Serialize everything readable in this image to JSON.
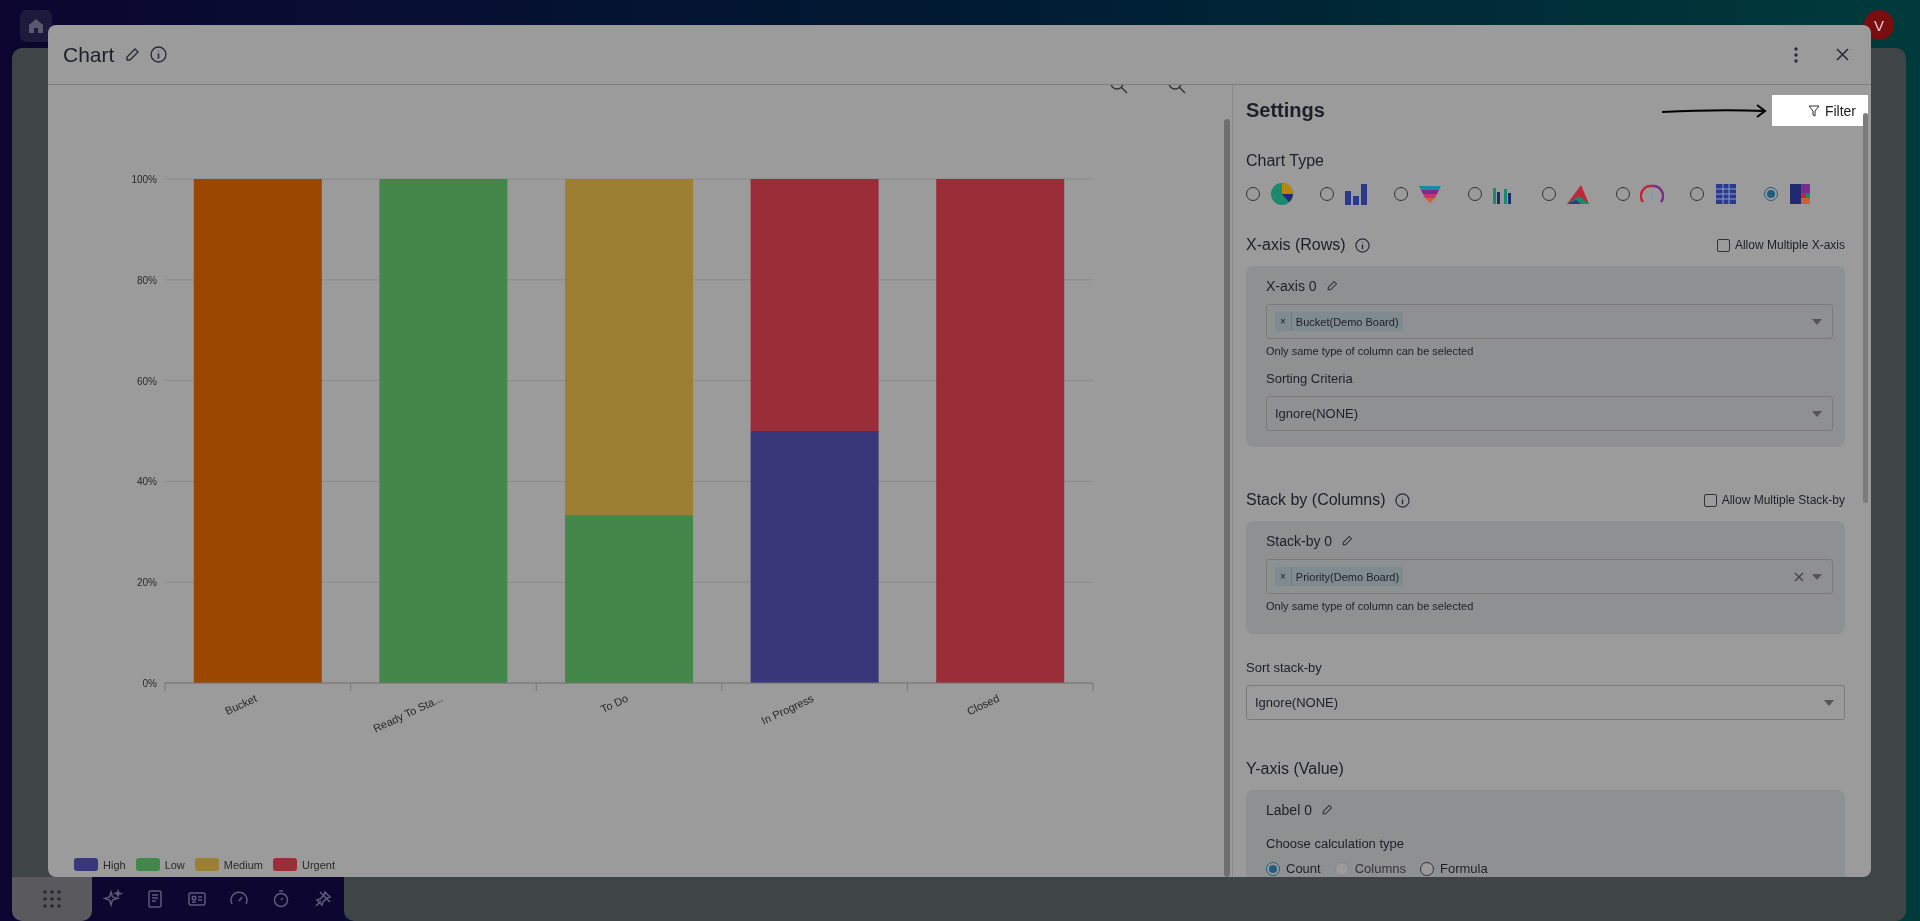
{
  "background": {
    "avatar": "V",
    "dock": [
      {
        "kind": "apps",
        "selected": true
      },
      {
        "kind": "sparkles",
        "selected": false
      },
      {
        "kind": "document",
        "selected": false
      },
      {
        "kind": "idcard",
        "selected": false
      },
      {
        "kind": "gauge",
        "selected": false
      },
      {
        "kind": "timer",
        "selected": false
      },
      {
        "kind": "unpin",
        "selected": false
      }
    ]
  },
  "modal": {
    "title": "Chart"
  },
  "chart": {
    "chart_data": {
      "type": "bar",
      "stacked": true,
      "grid": true,
      "categories": [
        "Bucket",
        "Ready To Sta...",
        "To Do",
        "In Progress",
        "Closed"
      ],
      "yticks": [
        {
          "value": 0,
          "label": "0%"
        },
        {
          "value": 20,
          "label": "20%"
        },
        {
          "value": 40,
          "label": "40%"
        },
        {
          "value": 60,
          "label": "60%"
        },
        {
          "value": 80,
          "label": "80%"
        },
        {
          "value": 100,
          "label": "100%"
        }
      ],
      "ylim": [
        0,
        100
      ],
      "series": [
        {
          "color": "#9c4700",
          "values": [
            100,
            null,
            null,
            null,
            null
          ]
        },
        {
          "name": "High",
          "color": "#383779",
          "values": [
            null,
            null,
            null,
            50,
            null
          ]
        },
        {
          "name": "Low",
          "color": "#44874a",
          "values": [
            null,
            100,
            33.3,
            null,
            null
          ]
        },
        {
          "name": "Medium",
          "color": "#9c7f32",
          "values": [
            null,
            null,
            66.7,
            null,
            null
          ]
        },
        {
          "name": "Urgent",
          "color": "#9b2d38",
          "values": [
            null,
            null,
            null,
            50,
            100
          ]
        }
      ]
    }
  },
  "settings": {
    "title": "Settings",
    "filter_button": "Filter",
    "chart_type": {
      "label": "Chart Type",
      "options": [
        {
          "kind": "pie",
          "selected": false
        },
        {
          "kind": "bar",
          "selected": false
        },
        {
          "kind": "funnel",
          "selected": false
        },
        {
          "kind": "grouped",
          "selected": false
        },
        {
          "kind": "area",
          "selected": false
        },
        {
          "kind": "gauge",
          "selected": false
        },
        {
          "kind": "table",
          "selected": false
        },
        {
          "kind": "treemap",
          "selected": true
        }
      ]
    },
    "x_axis": {
      "title": "X-axis (Rows)",
      "allow_multiple": {
        "label": "Allow Multiple X-axis",
        "checked": false
      },
      "items": [
        {
          "label": "X-axis 0",
          "tags": [
            {
              "remove": "×",
              "label": "Bucket(Demo Board)"
            }
          ],
          "clearable": false,
          "hint": "Only same type of column can be selected",
          "sorting_label": "Sorting Criteria",
          "sorting_value": "Ignore(NONE)"
        }
      ]
    },
    "stack_by": {
      "title": "Stack by (Columns)",
      "allow_multiple": {
        "label": "Allow Multiple Stack-by",
        "checked": false
      },
      "items": [
        {
          "label": "Stack-by 0",
          "tags": [
            {
              "remove": "×",
              "label": "Priority(Demo Board)"
            }
          ],
          "clearable": true,
          "hint": "Only same type of column can be selected"
        }
      ],
      "sort_label": "Sort stack-by",
      "sort_value": "Ignore(NONE)"
    },
    "y_axis": {
      "title": "Y-axis (Value)",
      "label": "Label 0",
      "calc_label": "Choose calculation type",
      "calc_options": [
        {
          "label": "Count",
          "selected": true,
          "disabled": false
        },
        {
          "label": "Columns",
          "selected": false,
          "disabled": true
        },
        {
          "label": "Formula",
          "selected": false,
          "disabled": false
        }
      ]
    }
  }
}
